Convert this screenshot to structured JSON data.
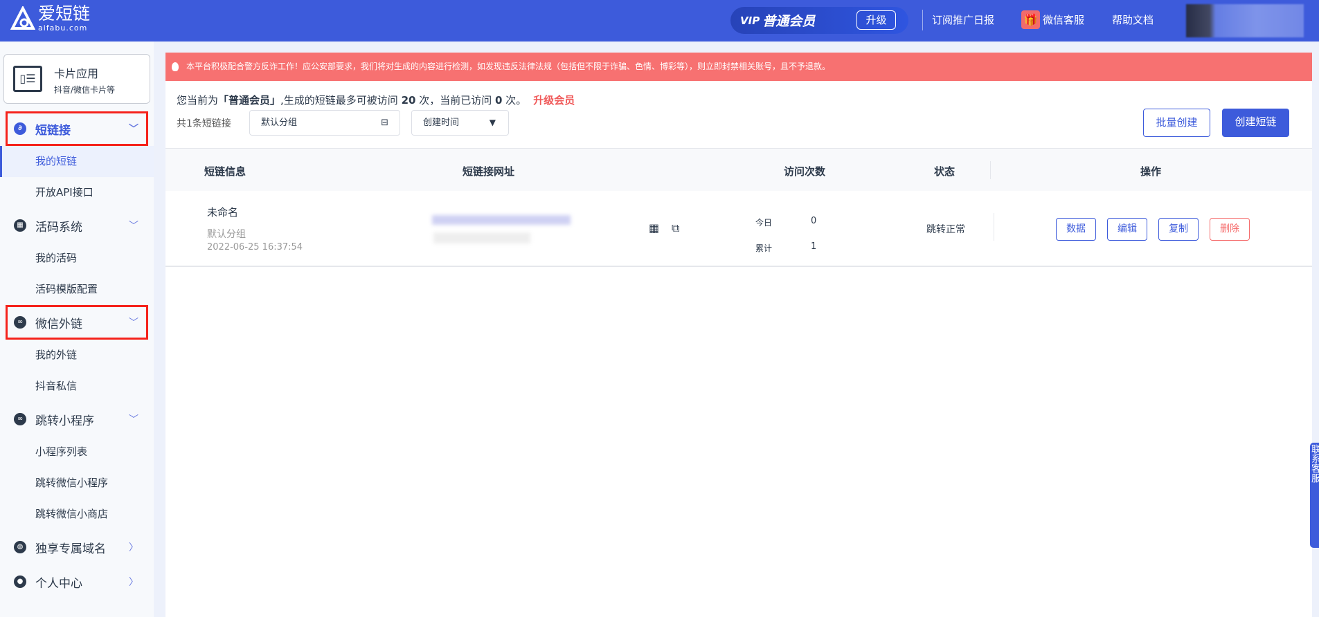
{
  "header": {
    "logo_name": "爱短链",
    "logo_domain": "aifabu.com",
    "vip_label": "普通会员",
    "vip_prefix": "VIP",
    "upgrade": "升级",
    "links": [
      "订阅推广日报",
      "微信客服",
      "帮助文档"
    ]
  },
  "sidebar": {
    "card": {
      "title": "卡片应用",
      "subtitle": "抖音/微信卡片等"
    },
    "groups": [
      {
        "label": "短链接",
        "icon": "link-icon",
        "items": [
          "我的短链",
          "开放API接口"
        ]
      },
      {
        "label": "活码系统",
        "icon": "qrcode-icon",
        "items": [
          "我的活码",
          "活码模版配置"
        ]
      },
      {
        "label": "微信外链",
        "icon": "wechat-icon",
        "items": [
          "我的外链",
          "抖音私信"
        ]
      },
      {
        "label": "跳转小程序",
        "icon": "miniprogram-icon",
        "items": [
          "小程序列表",
          "跳转微信小程序",
          "跳转微信小商店"
        ]
      },
      {
        "label": "独享专属域名",
        "icon": "globe-icon",
        "items": []
      },
      {
        "label": "个人中心",
        "icon": "user-icon",
        "items": []
      }
    ]
  },
  "main": {
    "alert": "本平台积极配合警方反诈工作！应公安部要求，我们将对生成的内容进行检测，如发现违反法律法规（包括但不限于诈骗、色情、博彩等），则立即封禁相关账号，且不予退款。",
    "info": {
      "p1": "您当前为",
      "level": "「普通会员」",
      "p2": ",生成的短链最多可被访问",
      "limit": "20",
      "p3": "次，当前已访问",
      "used": "0",
      "p4": "次。",
      "upgrade": "升级会员"
    },
    "count": "共1条短链接",
    "group_select": "默认分组",
    "sort_select": "创建时间",
    "batch_create": "批量创建",
    "create": "创建短链",
    "columns": [
      "短链信息",
      "短链接网址",
      "访问次数",
      "状态",
      "操作"
    ],
    "rows": [
      {
        "name": "未命名",
        "group": "默认分组",
        "created": "2022-06-25 16:37:54",
        "today_label": "今日",
        "today": "0",
        "total_label": "累计",
        "total": "1",
        "status": "跳转正常",
        "actions": [
          "数据",
          "编辑",
          "复制",
          "删除"
        ]
      }
    ]
  },
  "float_contact": "联系客服",
  "colors": {
    "primary": "#3d5bdb",
    "alert": "#f77171",
    "danger": "#f56c6c"
  }
}
